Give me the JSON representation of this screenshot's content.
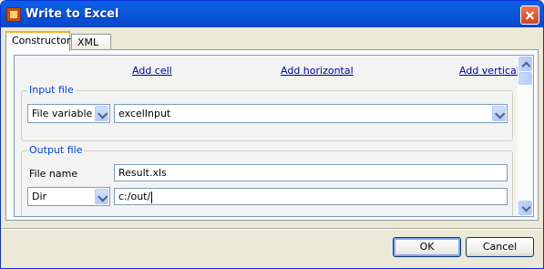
{
  "window": {
    "title": "Write to Excel",
    "app_icon": "excel-writer-icon",
    "close_icon": "close-icon"
  },
  "tabs": [
    {
      "label": "Constructor",
      "active": true
    },
    {
      "label": "XML",
      "active": false
    }
  ],
  "toolbar_links": {
    "add_cell": "Add cell",
    "add_horizontal": "Add horizontal",
    "add_vertical": "Add vertical"
  },
  "input_file": {
    "legend": "Input file",
    "type_select": "File variable",
    "variable_select": "excelInput"
  },
  "output_file": {
    "legend": "Output file",
    "file_name_label": "File name",
    "file_name_value": "Result.xls",
    "dir_select": "Dir",
    "dir_value": "c:/out/"
  },
  "buttons": {
    "ok": "OK",
    "cancel": "Cancel"
  },
  "colors": {
    "titlebar": "#0a5ad8",
    "link": "#00009c",
    "legend": "#0046d5"
  }
}
